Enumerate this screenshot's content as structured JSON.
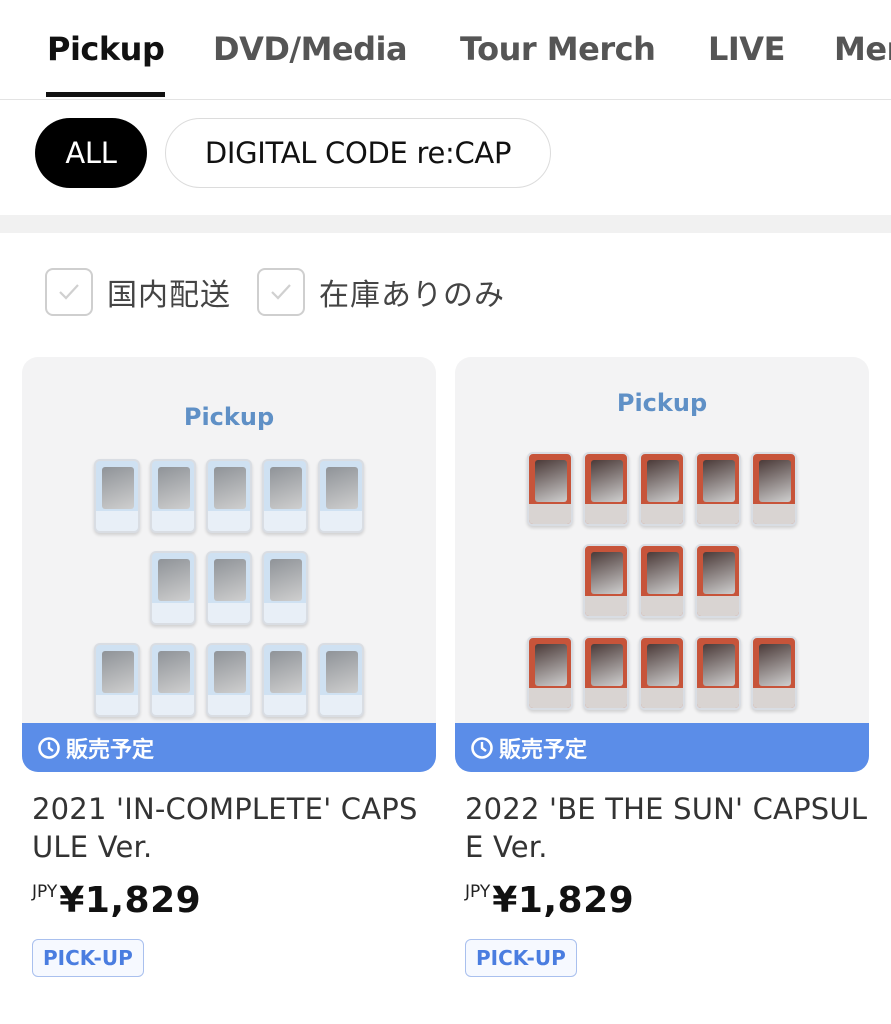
{
  "tabs": [
    {
      "label": "Pickup",
      "active": true
    },
    {
      "label": "DVD/Media",
      "active": false
    },
    {
      "label": "Tour Merch",
      "active": false
    },
    {
      "label": "LIVE",
      "active": false
    },
    {
      "label": "Mer",
      "active": false
    }
  ],
  "chips": [
    {
      "label": "ALL",
      "active": true
    },
    {
      "label": "DIGITAL CODE re:CAP",
      "active": false
    }
  ],
  "filters": [
    {
      "label": "国内配送",
      "checked": false
    },
    {
      "label": "在庫ありのみ",
      "checked": false
    }
  ],
  "products": [
    {
      "image_title": "Pickup",
      "status": "販売予定",
      "name": "2021 'IN-COMPLETE' CAPSULE Ver.",
      "currency": "JPY",
      "price": "¥1,829",
      "badge": "PICK-UP",
      "theme": {
        "capsule_bg": "#cfe1f2",
        "face": "#8f9398",
        "strip": "#e8eff7"
      }
    },
    {
      "image_title": "Pickup",
      "status": "販売予定",
      "name": "2022 'BE THE SUN' CAPSULE Ver.",
      "currency": "JPY",
      "price": "¥1,829",
      "badge": "PICK-UP",
      "theme": {
        "capsule_bg": "#c7543a",
        "face": "#4b3a38",
        "strip": "#d9d4d2"
      }
    }
  ],
  "colors": {
    "accent_blue": "#5b8de8",
    "tab_active": "#111111",
    "badge_text": "#4a7de0"
  }
}
